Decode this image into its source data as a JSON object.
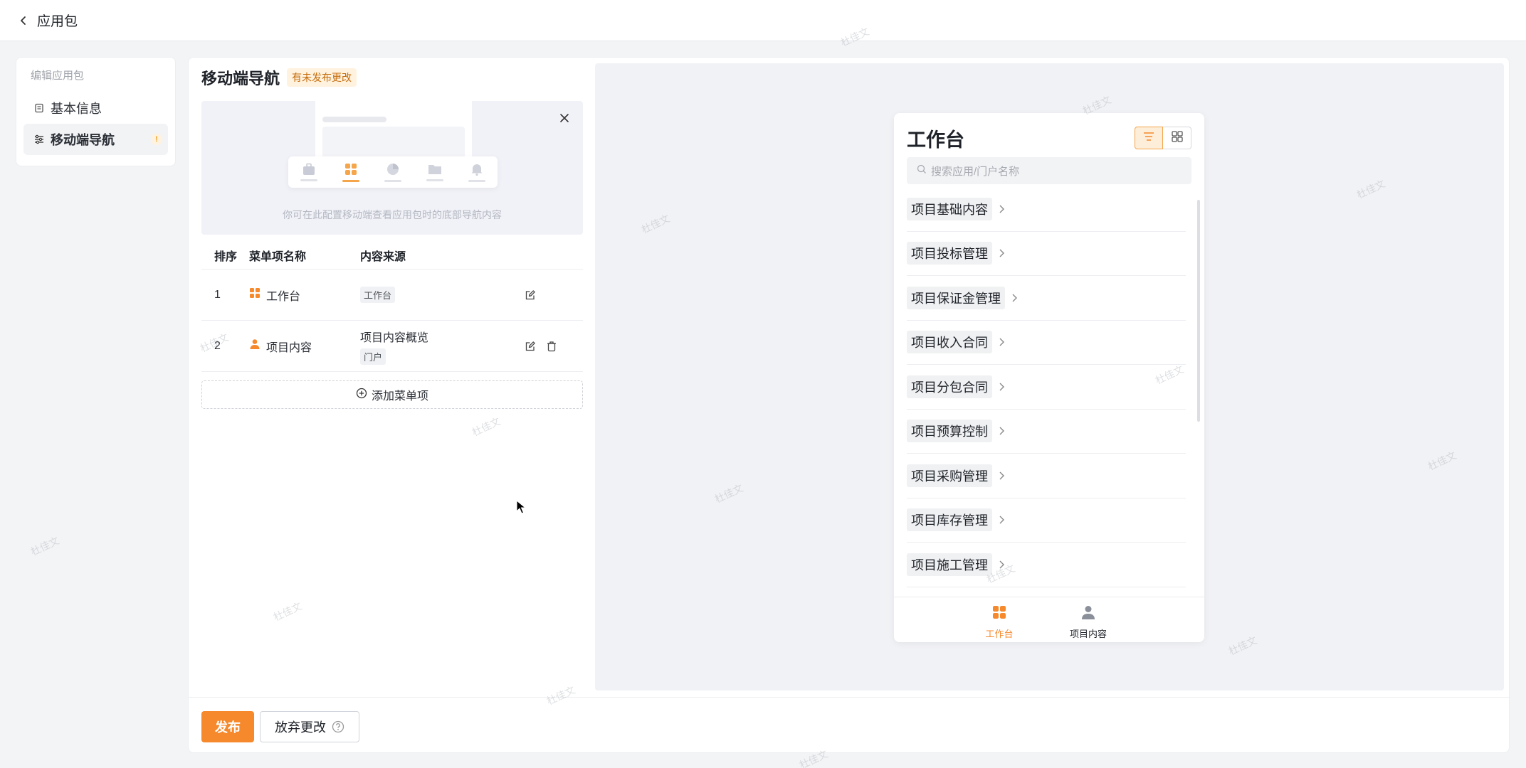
{
  "topbar": {
    "title": "应用包"
  },
  "sidebar": {
    "section_title": "编辑应用包",
    "items": [
      {
        "label": "基本信息",
        "icon": "document-icon",
        "active": false
      },
      {
        "label": "移动端导航",
        "icon": "list-settings-icon",
        "active": true,
        "warning": "!"
      }
    ]
  },
  "main": {
    "title": "移动端导航",
    "status_badge": "有未发布更改",
    "banner_text": "你可在此配置移动端查看应用包时的底部导航内容",
    "table": {
      "headers": [
        "排序",
        "菜单项名称",
        "内容来源"
      ],
      "rows": [
        {
          "order": "1",
          "name": "工作台",
          "icon": "grid-icon",
          "source_tag": "工作台"
        },
        {
          "order": "2",
          "name": "项目内容",
          "icon": "person-icon",
          "source_text": "项目内容概览",
          "source_tag": "门户"
        }
      ]
    },
    "add_label": "添加菜单项",
    "footer": {
      "publish_label": "发布",
      "discard_label": "放弃更改"
    }
  },
  "preview": {
    "title": "工作台",
    "search_placeholder": "搜索应用/门户名称",
    "items": [
      "项目基础内容",
      "项目投标管理",
      "项目保证金管理",
      "项目收入合同",
      "项目分包合同",
      "项目预算控制",
      "项目采购管理",
      "项目库存管理",
      "项目施工管理"
    ],
    "tabs": [
      {
        "label": "工作台",
        "active": true
      },
      {
        "label": "项目内容",
        "active": false
      }
    ]
  },
  "watermark": "杜佳文",
  "colors": {
    "accent": "#f5892b",
    "accent_light": "#fdeed9",
    "badge_bg": "#fff2de"
  }
}
